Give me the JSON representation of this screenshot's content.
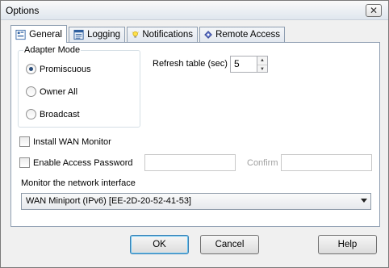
{
  "window": {
    "title": "Options",
    "close_glyph": "✕"
  },
  "tabs": [
    {
      "label": "General",
      "icon": "general-icon",
      "active": true
    },
    {
      "label": "Logging",
      "icon": "logging-icon",
      "active": false
    },
    {
      "label": "Notifications",
      "icon": "lightbulb-icon",
      "active": false
    },
    {
      "label": "Remote Access",
      "icon": "remote-access-icon",
      "active": false
    }
  ],
  "adapter_mode": {
    "label": "Adapter Mode",
    "options": [
      {
        "label": "Promiscuous",
        "checked": true
      },
      {
        "label": "Owner All",
        "checked": false
      },
      {
        "label": "Broadcast",
        "checked": false
      }
    ]
  },
  "refresh": {
    "label": "Refresh table (sec)",
    "value": "5"
  },
  "install_wan": {
    "label": "Install WAN Monitor",
    "checked": false
  },
  "access_password": {
    "label": "Enable Access Password",
    "checked": false,
    "password_value": "",
    "confirm_label": "Confirm",
    "confirm_value": ""
  },
  "monitor": {
    "label": "Monitor the network interface",
    "selected": "WAN Miniport (IPv6) [EE-2D-20-52-41-53]"
  },
  "buttons": {
    "ok": "OK",
    "cancel": "Cancel",
    "help": "Help"
  },
  "colors": {
    "accent": "#3c7fb1",
    "radio_dot": "#2a4d7a"
  }
}
